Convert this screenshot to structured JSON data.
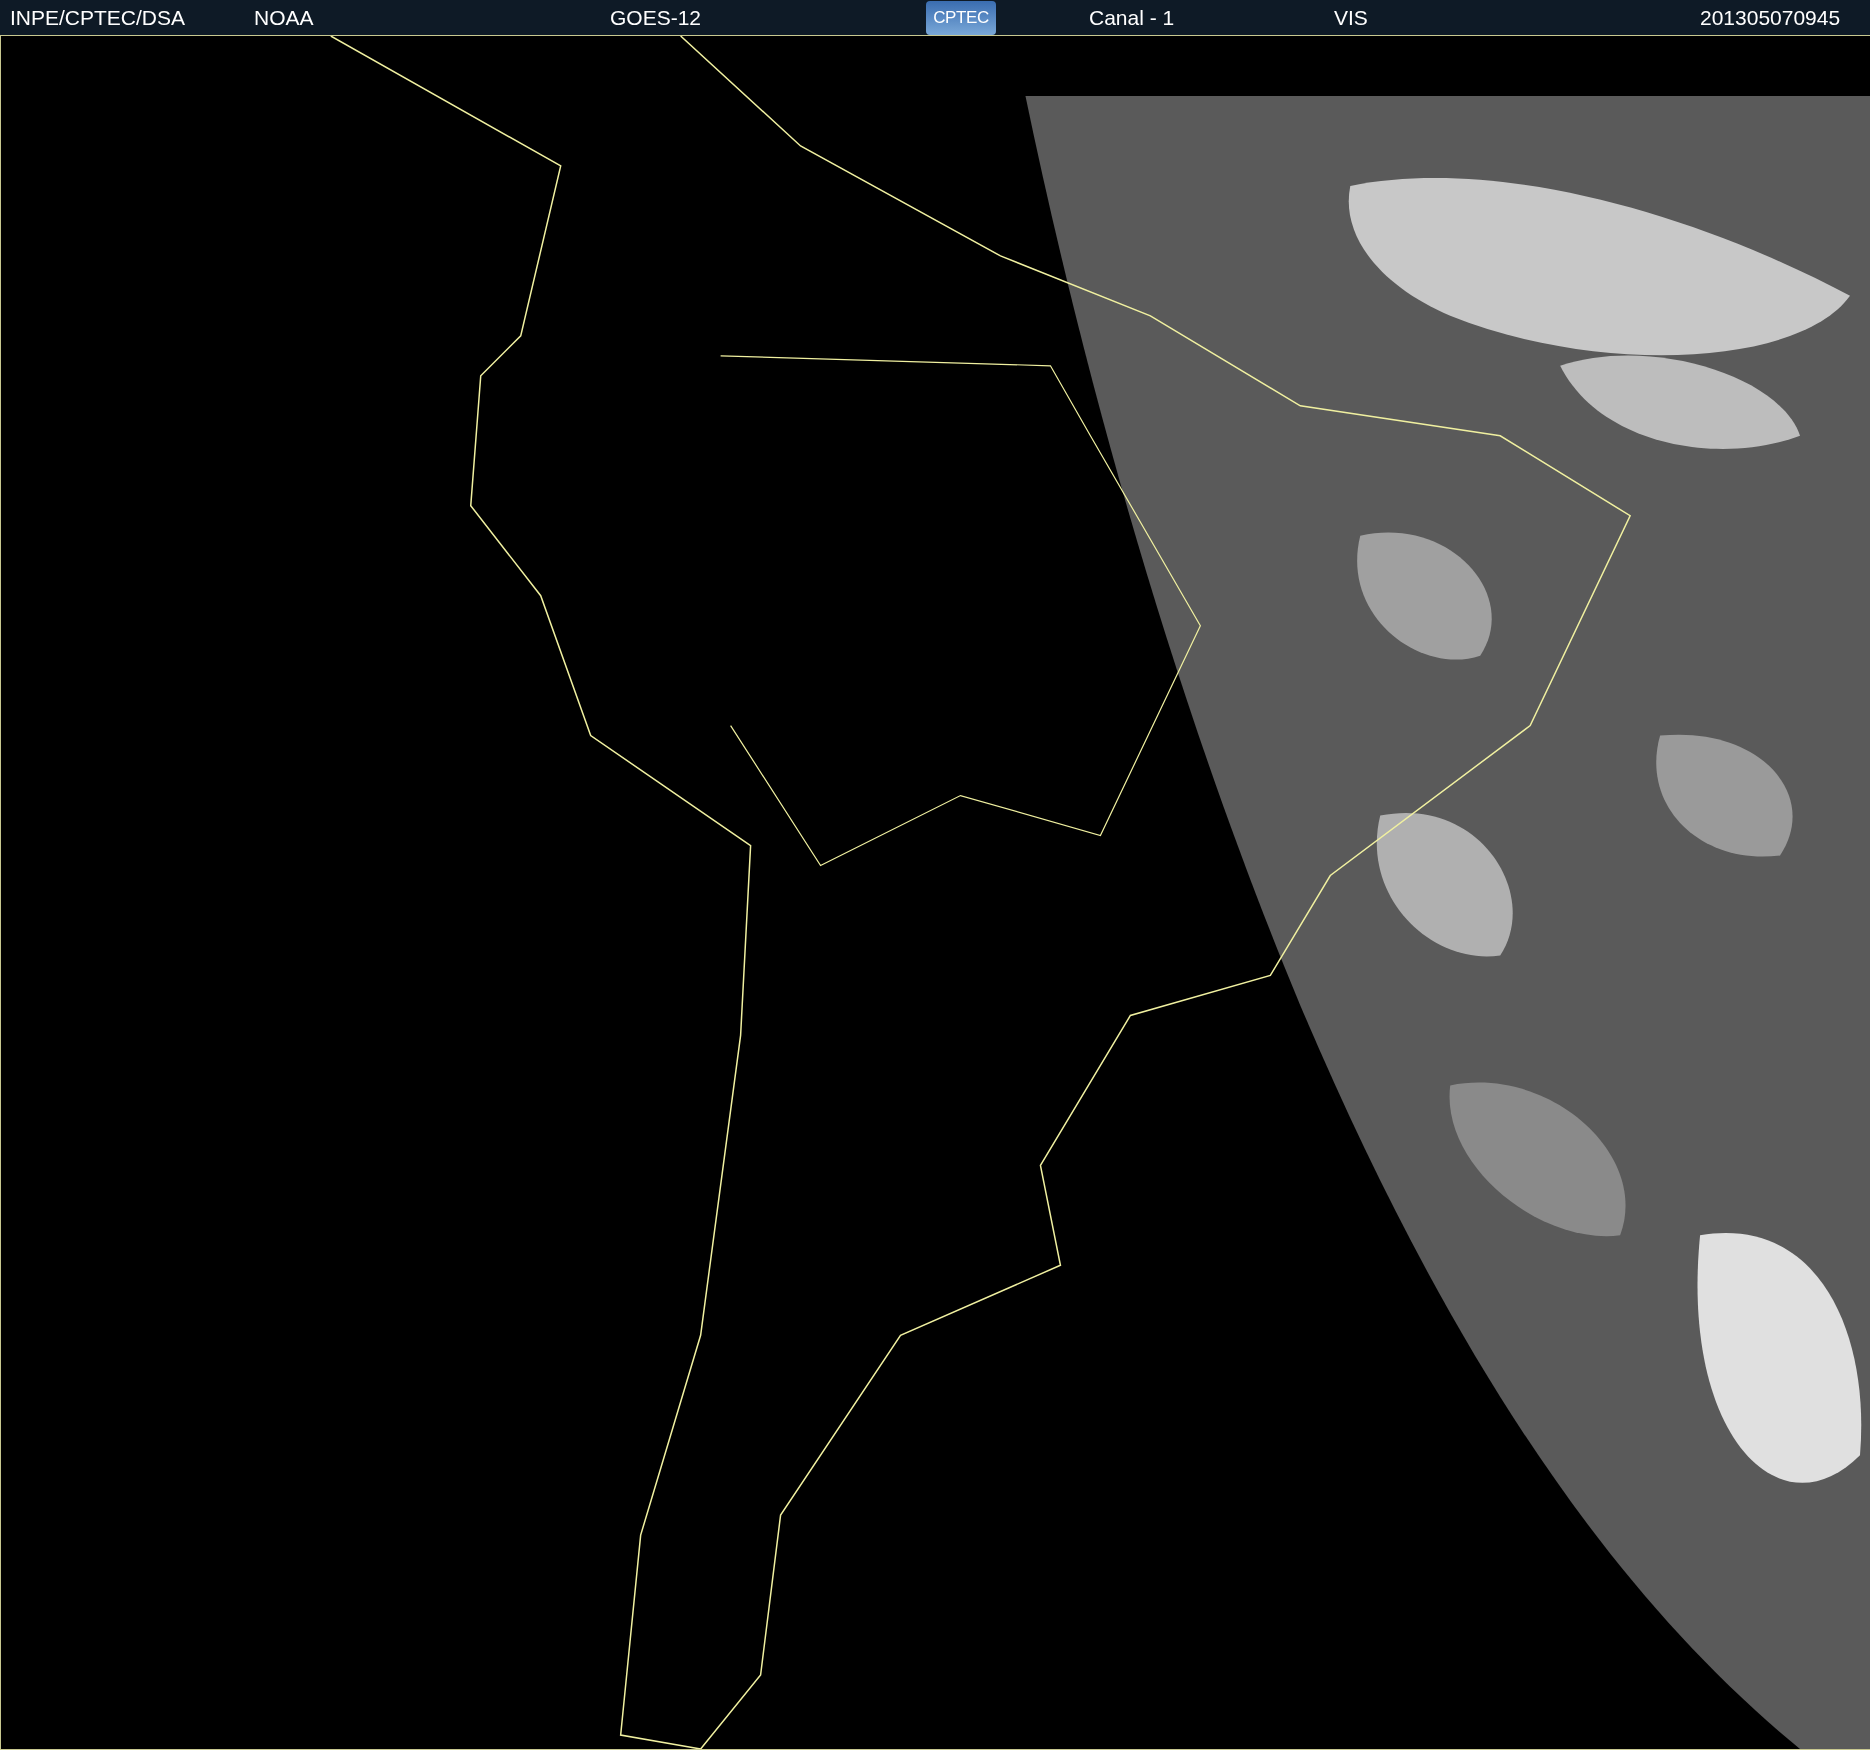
{
  "header": {
    "items": [
      {
        "kind": "text",
        "text": "INPE/CPTEC/DSA"
      },
      {
        "kind": "text",
        "text": "NOAA"
      },
      {
        "kind": "text",
        "text": "GOES-12"
      },
      {
        "kind": "logo",
        "text": "CPTEC"
      },
      {
        "kind": "text",
        "text": "Canal - 1"
      },
      {
        "kind": "text",
        "text": "VIS"
      },
      {
        "kind": "text",
        "text": "201305070945"
      }
    ]
  }
}
